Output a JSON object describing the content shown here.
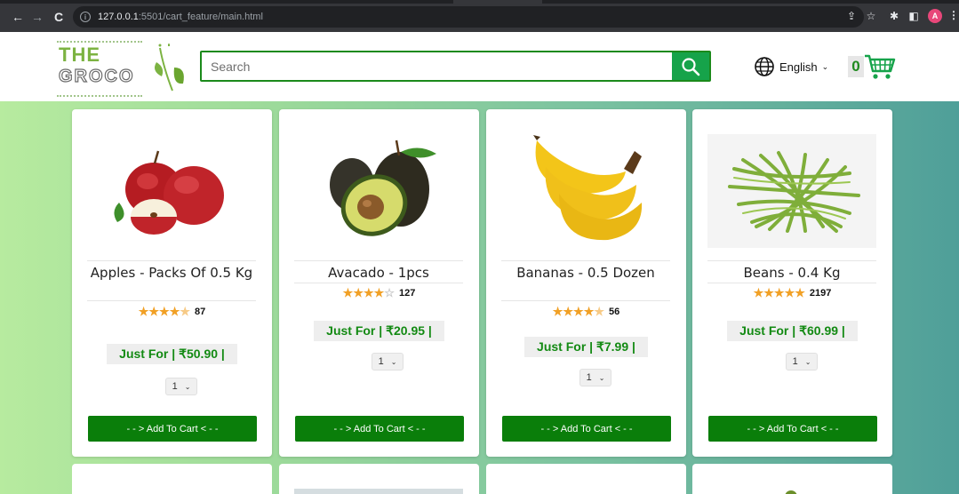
{
  "browser": {
    "url_host": "127.0.0.1",
    "url_rest": ":5501/cart_feature/main.html"
  },
  "header": {
    "logo_top": "THE",
    "logo_bottom": "GROCO",
    "search_placeholder": "Search",
    "language": "English",
    "cart_count": "0"
  },
  "colors": {
    "brand_green": "#0a7e0a",
    "price_green": "#138a13",
    "star": "#f1a025"
  },
  "products": [
    {
      "name": "Apples - Packs Of 0.5 Kg",
      "rating": 4.5,
      "reviews": "87",
      "price": "Just For | ₹50.90 |",
      "qty": "1",
      "button": "- - > Add To Cart < - -"
    },
    {
      "name": "Avacado - 1pcs",
      "rating": 4,
      "reviews": "127",
      "price": "Just For | ₹20.95 |",
      "qty": "1",
      "button": "- - > Add To Cart < - -"
    },
    {
      "name": "Bananas - 0.5 Dozen",
      "rating": 4.5,
      "reviews": "56",
      "price": "Just For | ₹7.99 |",
      "qty": "1",
      "button": "- - > Add To Cart < - -"
    },
    {
      "name": "Beans - 0.4 Kg",
      "rating": 5,
      "reviews": "2197",
      "price": "Just For | ₹60.99 |",
      "qty": "1",
      "button": "- - > Add To Cart < - -"
    }
  ]
}
